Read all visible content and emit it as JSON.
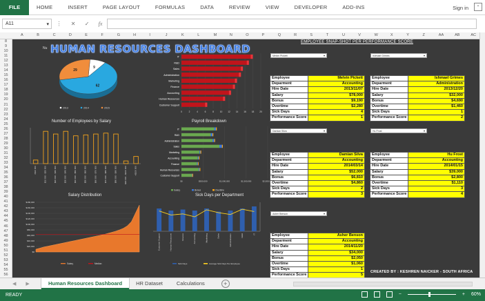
{
  "ribbon": {
    "file": "FILE",
    "tabs": [
      "HOME",
      "INSERT",
      "PAGE LAYOUT",
      "FORMULAS",
      "DATA",
      "REVIEW",
      "VIEW",
      "DEVELOPER",
      "ADD-INS"
    ],
    "signin": "Sign in"
  },
  "formula_bar": {
    "name_box": "A11",
    "value": ""
  },
  "columns": [
    "A",
    "B",
    "C",
    "D",
    "E",
    "F",
    "G",
    "H",
    "I",
    "J",
    "K",
    "L",
    "M",
    "N",
    "O",
    "P",
    "Q",
    "R",
    "S",
    "T",
    "U",
    "V",
    "W",
    "X",
    "Y",
    "Z",
    "AA",
    "AB",
    "AC"
  ],
  "rows": [
    "8",
    "9",
    "10",
    "11",
    "12",
    "13",
    "14",
    "15",
    "16",
    "17",
    "18",
    "19",
    "20",
    "21",
    "22",
    "23",
    "24",
    "25",
    "26",
    "27",
    "28",
    "29",
    "30",
    "31",
    "32",
    "33",
    "34",
    "35",
    "36",
    "37",
    "38",
    "39",
    "40",
    "41",
    "42",
    "43",
    "44",
    "45",
    "46",
    "47",
    "48",
    "49",
    "50",
    "51",
    "52",
    "53",
    "54",
    "55",
    "56"
  ],
  "dashboard": {
    "title": "HUMAN RESOURCES DASHBOARD",
    "nu": "Nu",
    "snapshot_title": "EMPLOYEE SNAP-SHOT PER PERFORMANCE SCORE",
    "credit": "CREATED BY : KESHREN NAICKER - SOUTH AFRICA",
    "colors": {
      "background": "#3a3a3a",
      "title": "#3d7be3",
      "card_value": "#ffff00",
      "bar_red": "#c0141b",
      "salary_green": "#6aa84f",
      "bonus_blue": "#3c78d8",
      "overtime_orange": "#f1a21c"
    }
  },
  "chart_data": [
    {
      "type": "pie",
      "title": "",
      "categories": [
        "2013",
        "2014",
        "2015"
      ],
      "values": [
        9,
        62,
        29
      ],
      "colors": [
        "#ffffff",
        "#29a8e0",
        "#f08d3c"
      ],
      "legend": "bottom"
    },
    {
      "type": "bar",
      "orientation": "horizontal",
      "title": "",
      "categories": [
        "IT",
        "R&D",
        "Sales",
        "Administration",
        "Marketing",
        "Finance",
        "Accounting",
        "Human Resources",
        "Customer Support"
      ],
      "values": [
        18,
        17,
        15.5,
        15,
        14,
        13.5,
        12.5,
        11,
        6.5
      ],
      "xticks": [
        "0",
        "2",
        "4",
        "6",
        "8",
        "10",
        "12",
        "14",
        "16",
        "18",
        "20"
      ],
      "xlim": [
        0,
        20
      ]
    },
    {
      "type": "bar",
      "title": "Number of Employees by Salary",
      "categories": [
        "<$10 000",
        "$10 000 - $20 000",
        "$20 000 - $30 000",
        "$30 000 - $40 000",
        "$40 000 - $50 000",
        "$50 000 - $60 000",
        "$60 000 - $70 000",
        "$70 000 - $80 000",
        "$80 000 - $90 000",
        "$90 000 - $100 000",
        ">$100 000"
      ],
      "values": [
        4,
        36,
        33,
        36,
        31,
        32,
        33,
        34,
        33,
        3,
        8
      ],
      "ylim": [
        0,
        40
      ]
    },
    {
      "type": "bar",
      "orientation": "horizontal",
      "title": "Payroll Breakdown",
      "categories": [
        "IT",
        "R&D",
        "Administration",
        "Sales",
        "Marketing",
        "Accounting",
        "Finance",
        "Human Resources",
        "Customer Support"
      ],
      "series": [
        {
          "name": "Salary",
          "values": [
            760000,
            680000,
            720000,
            880000,
            420000,
            380000,
            360000,
            400000,
            240000
          ]
        },
        {
          "name": "Bonus",
          "values": [
            40000,
            40000,
            40000,
            60000,
            20000,
            20000,
            20000,
            20000,
            10000
          ]
        },
        {
          "name": "Overtime",
          "values": [
            20000,
            20000,
            20000,
            20000,
            10000,
            10000,
            10000,
            10000,
            10000
          ]
        }
      ],
      "xticks": [
        "$0",
        "$500,000",
        "$1,000,000",
        "$1,500,000",
        "$2,000,000"
      ],
      "xlim": [
        0,
        2000000
      ],
      "legend": "bottom"
    },
    {
      "type": "area",
      "title": "Salary Distribution",
      "series": [
        {
          "name": "Salary",
          "values": [
            10000,
            14000,
            18000,
            21000,
            24000,
            27000,
            30000,
            33000,
            36000,
            39000,
            42000,
            45000,
            48000,
            51000,
            54000,
            57000,
            60000,
            63000,
            67000,
            71000,
            75000,
            80000,
            86000,
            95000,
            110000,
            140000,
            170000
          ]
        },
        {
          "name": "Median",
          "values": [
            64000
          ]
        }
      ],
      "yticks": [
        "$0",
        "$20,000",
        "$40,000",
        "$60,000",
        "$80,000",
        "$100,000",
        "$120,000",
        "$140,000",
        "$160,000",
        "$180,000"
      ],
      "ylim": [
        0,
        180000
      ],
      "legend": "bottom"
    },
    {
      "type": "bar",
      "title": "Sick Days per Department",
      "categories": [
        "Customer Support",
        "Human Resources",
        "Finance",
        "Accounting",
        "Marketing",
        "Sales",
        "Administration",
        "R&D",
        "IT"
      ],
      "series": [
        {
          "name": "Sick Days",
          "values": [
            110,
            100,
            105,
            100,
            110,
            95,
            100,
            110,
            120
          ]
        },
        {
          "name": "Average Sick Days Per Employee",
          "values": [
            3.5,
            2.8,
            3.0,
            2.5,
            3.7,
            3.2,
            2.9,
            3.8,
            3.4
          ]
        }
      ],
      "ylim": [
        0,
        140
      ],
      "y2lim": [
        0,
        5
      ],
      "legend": "bottom"
    }
  ],
  "dropdowns": [
    "Melvin Pickett",
    "Ishmael Grimes",
    "Damian Silva",
    "Hu Frost",
    "Asher Benson"
  ],
  "cards": [
    {
      "employee": "Melvin Pickett",
      "department": "Accounting",
      "hire_date": "2013/11/07",
      "salary": "$78,000",
      "bonus": "$9,190",
      "overtime": "$2,280",
      "sick_days": "4",
      "performance": "1"
    },
    {
      "employee": "Ishmael Grimes",
      "department": "Administration",
      "hire_date": "2013/12/20",
      "salary": "$32,000",
      "bonus": "$4,690",
      "overtime": "$1,460",
      "sick_days": "1",
      "performance": "2"
    },
    {
      "employee": "Damian Silva",
      "department": "Accounting",
      "hire_date": "2014/03/14",
      "salary": "$52,000",
      "bonus": "$6,810",
      "overtime": "$4,860",
      "sick_days": "2",
      "performance": "3"
    },
    {
      "employee": "Hu Frost",
      "department": "Accounting",
      "hire_date": "2014/01/15",
      "salary": "$39,000",
      "bonus": "$2,800",
      "overtime": "$1,110",
      "sick_days": "3",
      "performance": "4"
    },
    {
      "employee": "Asher Benson",
      "department": "Accounting",
      "hire_date": "2014/11/20",
      "salary": "$34,000",
      "bonus": "$2,050",
      "overtime": "$1,060",
      "sick_days": "1",
      "performance": "5"
    }
  ],
  "card_labels": {
    "employee": "Employee",
    "department": "Deparment",
    "hire_date": "Hire Date",
    "salary": "Salary",
    "bonus": "Bonus",
    "overtime": "Overtime",
    "sick_days": "Sick Days",
    "performance": "Performance Score"
  },
  "sheets": {
    "tabs": [
      "Human Resources Dashboard",
      "HR Dataset",
      "Calculations"
    ],
    "active": "Human Resources Dashboard"
  },
  "status": {
    "ready": "READY",
    "zoom": "60%"
  }
}
